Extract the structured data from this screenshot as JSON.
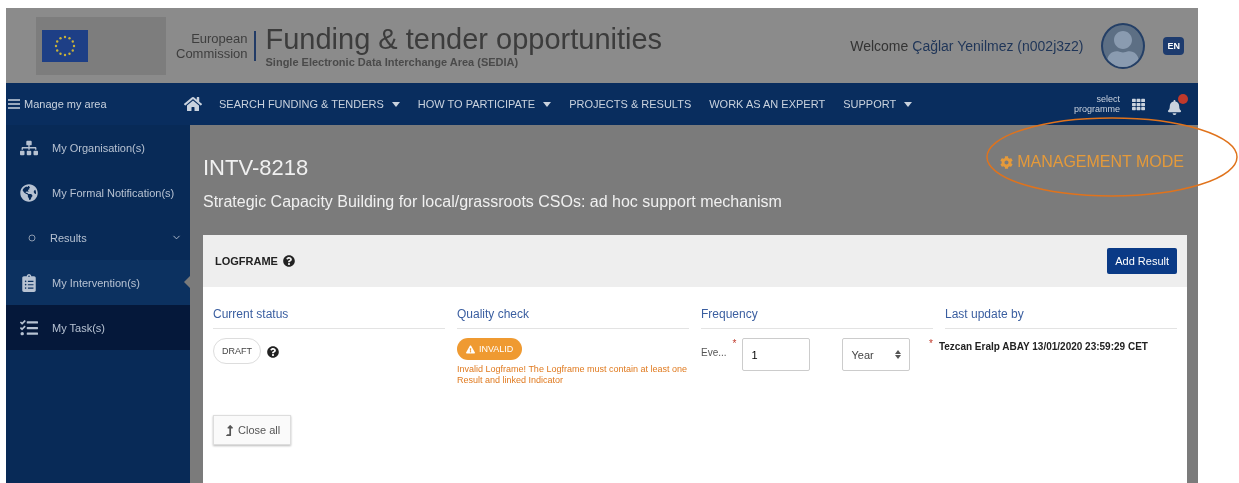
{
  "header": {
    "org_line1": "European",
    "org_line2": "Commission",
    "title": "Funding & tender opportunities",
    "subtitle": "Single Electronic Data Interchange Area (SEDIA)",
    "welcome": "Welcome",
    "user": "Çağlar Yenilmez (n002j3z2)",
    "language": "EN"
  },
  "nav": {
    "menu_label": "Manage my area",
    "items": [
      {
        "label": "SEARCH FUNDING & TENDERS",
        "dropdown": true
      },
      {
        "label": "HOW TO PARTICIPATE",
        "dropdown": true
      },
      {
        "label": "PROJECTS & RESULTS",
        "dropdown": false
      },
      {
        "label": "WORK AS AN EXPERT",
        "dropdown": false
      },
      {
        "label": "SUPPORT",
        "dropdown": true
      }
    ],
    "programme_line1": "select",
    "programme_line2": "programme"
  },
  "sidebar": {
    "items": [
      {
        "label": "My Organisation(s)",
        "kind": "link",
        "selected": false,
        "highlighted": false
      },
      {
        "label": "My Formal Notification(s)",
        "kind": "link",
        "selected": false,
        "highlighted": false
      },
      {
        "label": "Results",
        "kind": "sub",
        "selected": false,
        "highlighted": false
      },
      {
        "label": "My Intervention(s)",
        "kind": "link",
        "selected": true,
        "highlighted": false
      },
      {
        "label": "My Task(s)",
        "kind": "link",
        "selected": false,
        "highlighted": true
      }
    ]
  },
  "page": {
    "code": "INTV-8218",
    "title": "Strategic Capacity Building for local/grassroots CSOs: ad hoc support mechanism",
    "mode": "MANAGEMENT MODE"
  },
  "logframe": {
    "title": "LOGFRAME",
    "add_button": "Add Result",
    "columns": [
      "Current status",
      "Quality check",
      "Frequency",
      "Last update by"
    ],
    "status": "DRAFT",
    "quality_badge": "INVALID",
    "quality_message": "Invalid Logframe! The Logframe must contain at least one Result and linked Indicator",
    "frequency_label": "Eve...",
    "frequency_required_mark": "*",
    "update_required_mark": "*",
    "frequency_value": "1",
    "frequency_unit": "Year",
    "last_update": "Tezcan Eralp ABAY 13/01/2020 23:59:29 CET",
    "close_button": "Close all"
  }
}
